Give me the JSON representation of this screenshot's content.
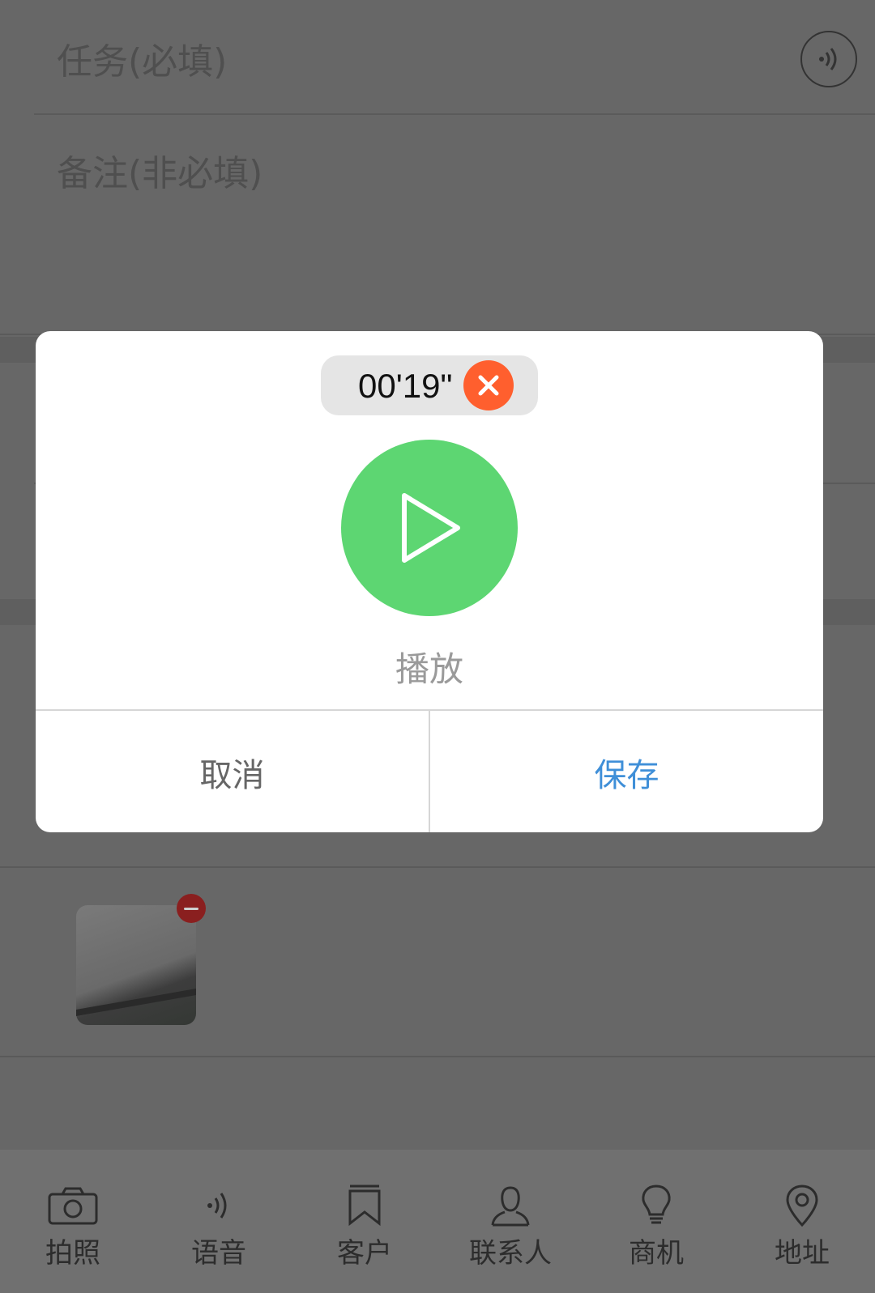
{
  "form": {
    "task_placeholder": "任务(必填)",
    "note_placeholder": "备注(非必填)"
  },
  "dialog": {
    "timer": "00'19\"",
    "play_label": "播放",
    "cancel_label": "取消",
    "save_label": "保存"
  },
  "tabbar": {
    "items": [
      {
        "label": "拍照",
        "icon": "camera-icon"
      },
      {
        "label": "语音",
        "icon": "voice-icon"
      },
      {
        "label": "客户",
        "icon": "bookmark-icon"
      },
      {
        "label": "联系人",
        "icon": "person-icon"
      },
      {
        "label": "商机",
        "icon": "lightbulb-icon"
      },
      {
        "label": "地址",
        "icon": "location-pin-icon"
      }
    ]
  },
  "colors": {
    "play_green": "#5dd672",
    "close_orange": "#ff5f2e",
    "save_blue": "#3f8fd8"
  }
}
